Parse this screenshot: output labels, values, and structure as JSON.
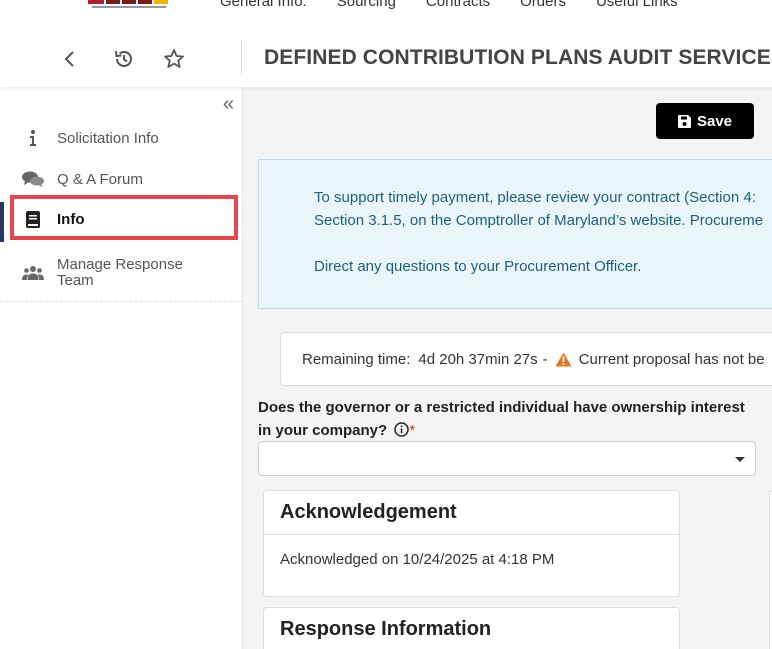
{
  "header": {
    "nav": [
      "General Info.",
      "Sourcing",
      "Contracts",
      "Orders",
      "Useful Links"
    ],
    "page_title": "DEFINED CONTRIBUTION PLANS AUDIT SERVICES",
    "icons": [
      "back-arrow-icon",
      "history-icon",
      "star-icon"
    ]
  },
  "sidebar": {
    "collapse_icon": "«",
    "items": [
      {
        "label": "Solicitation Info",
        "icon": "info-icon"
      },
      {
        "label": "Q & A Forum",
        "icon": "chat-bubbles-icon"
      },
      {
        "label": "Info",
        "icon": "book-icon",
        "active": true
      },
      {
        "label": "Manage Response Team",
        "icon": "people-icon"
      }
    ]
  },
  "toolbar": {
    "save_label": "Save"
  },
  "notice": {
    "line1": "To support timely payment, please review your contract (Section 4:",
    "line2": "Section 3.1.5, on the Comptroller of Maryland’s website. Procureme",
    "line3": "Direct any questions to your Procurement Officer."
  },
  "timer": {
    "label": "Remaining time:",
    "value": "4d 20h 37min 27s",
    "separator": "-",
    "warning": "Current proposal has not be"
  },
  "question": {
    "text": "Does the governor or a restricted individual have ownership interest in your company?",
    "required_mark": "*",
    "select_value": ""
  },
  "acknowledgement": {
    "title": "Acknowledgement",
    "text": "Acknowledged on 10/24/2025 at 4:18 PM"
  },
  "response_info": {
    "title": "Response Information"
  },
  "colors": {
    "accent": "#2a3560",
    "highlight": "#e8464b",
    "notice_bg": "#eaf5fa",
    "notice_text": "#1e5e82",
    "warning": "#e8741a"
  }
}
